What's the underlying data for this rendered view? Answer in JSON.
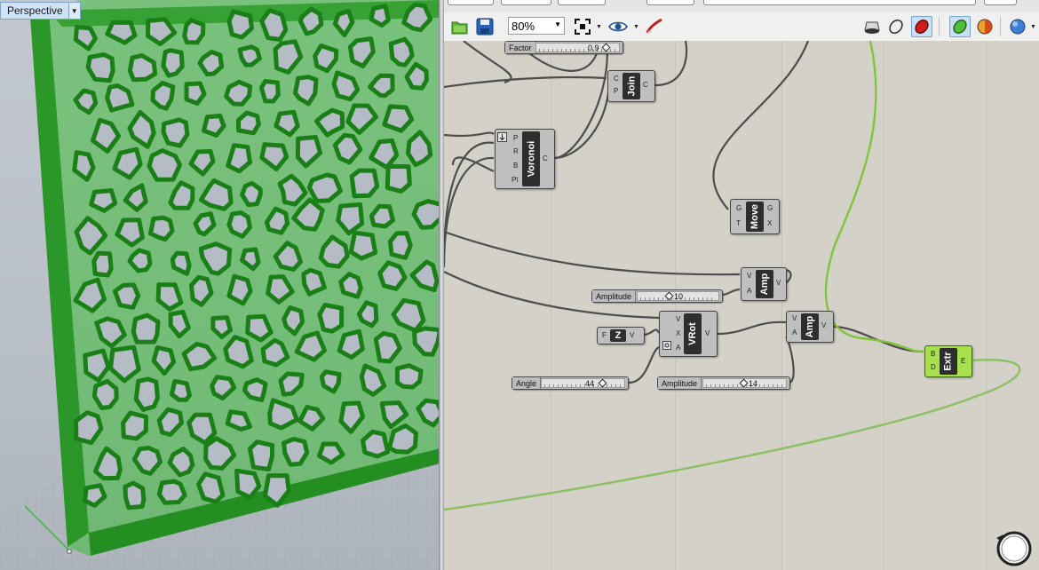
{
  "viewport": {
    "title": "Perspective",
    "menu_icon": "chevron-down-icon"
  },
  "toolbar": {
    "zoom": "80%",
    "icons": [
      "open-file-icon",
      "save-file-icon",
      "zoom-extents-icon",
      "preview-eye-icon",
      "sketch-icon",
      "preview-wireframe-icon",
      "preview-shaded-icon",
      "preview-selected-icon",
      "display-mode-icon",
      "color-sphere-icon",
      "blue-sphere-icon"
    ]
  },
  "components": {
    "voronoi": {
      "name": "Voronoi",
      "inputs": [
        "P",
        "R",
        "B",
        "Pl"
      ],
      "outputs": [
        "C"
      ]
    },
    "join": {
      "name": "Join",
      "inputs": [
        "C",
        "P"
      ],
      "outputs": [
        "C"
      ]
    },
    "move": {
      "name": "Move",
      "inputs": [
        "G",
        "T"
      ],
      "outputs": [
        "G",
        "X"
      ]
    },
    "amp1": {
      "name": "Amp",
      "inputs": [
        "V",
        "A"
      ],
      "outputs": [
        "V"
      ]
    },
    "amp2": {
      "name": "Amp",
      "inputs": [
        "V",
        "A"
      ],
      "outputs": [
        "V"
      ]
    },
    "vrot": {
      "name": "VRot",
      "inputs": [
        "V",
        "X",
        "A"
      ],
      "outputs": [
        "V"
      ]
    },
    "zvec": {
      "name": "Z",
      "inputs": [
        "F"
      ],
      "outputs": [
        "V"
      ]
    },
    "extr": {
      "name": "Extr",
      "inputs": [
        "B",
        "D"
      ],
      "outputs": [
        "E"
      ]
    }
  },
  "sliders": {
    "factor": {
      "name": "Factor",
      "value": "0.9"
    },
    "amplitude1": {
      "name": "Amplitude",
      "value": "10"
    },
    "angle": {
      "name": "Angle",
      "value": "44"
    },
    "amplitude2": {
      "name": "Amplitude",
      "value": "14"
    }
  },
  "colors": {
    "preview_green": "#2fa82a",
    "canvas": "#d4d1c9",
    "selected_component": "#a8e04e"
  }
}
